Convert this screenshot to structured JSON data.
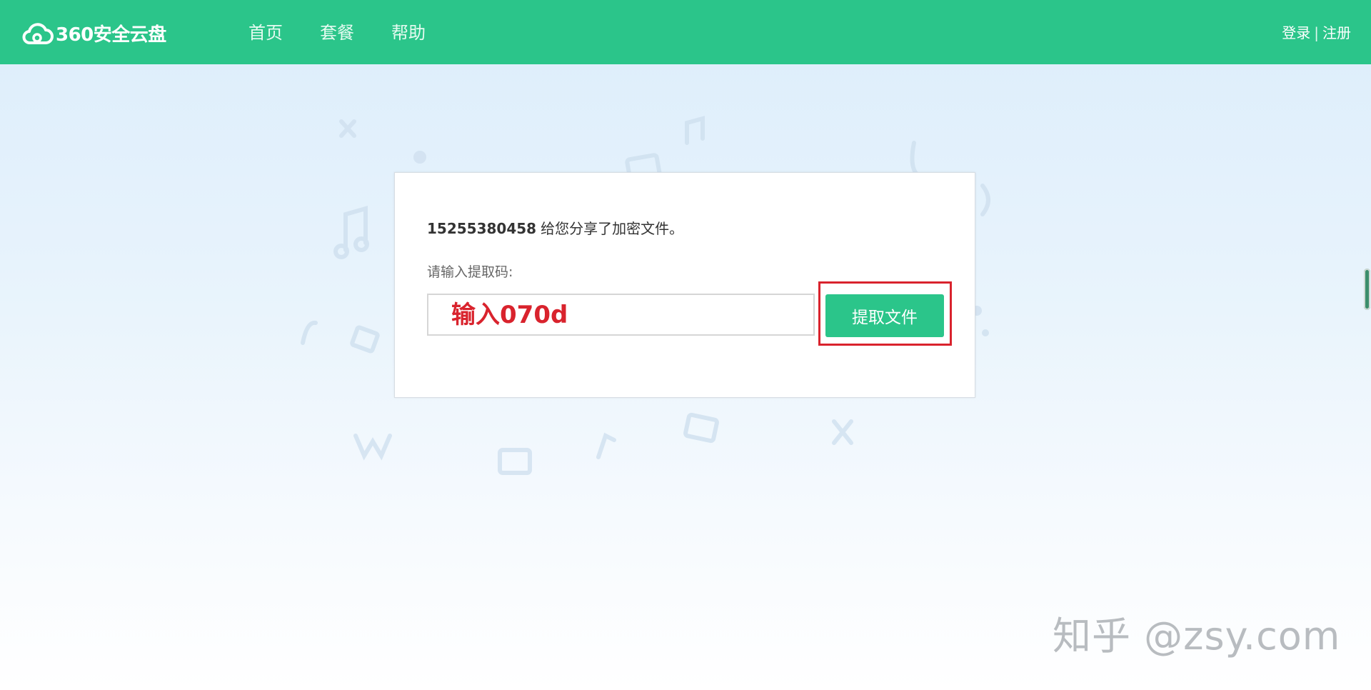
{
  "header": {
    "brand": "360安全云盘",
    "nav": [
      {
        "label": "首页"
      },
      {
        "label": "套餐"
      },
      {
        "label": "帮助"
      }
    ],
    "login_label": "登录",
    "separator": "|",
    "register_label": "注册"
  },
  "card": {
    "sharer": "15255380458",
    "share_message": "给您分享了加密文件。",
    "prompt": "请输入提取码:",
    "code_placeholder": "输入070d",
    "extract_button_label": "提取文件"
  },
  "watermark": "知乎 @zsy.com",
  "colors": {
    "brand_green": "#2bc58a",
    "highlight_red": "#d9232d"
  },
  "icons": {
    "logo": "cloud-logo-icon"
  }
}
